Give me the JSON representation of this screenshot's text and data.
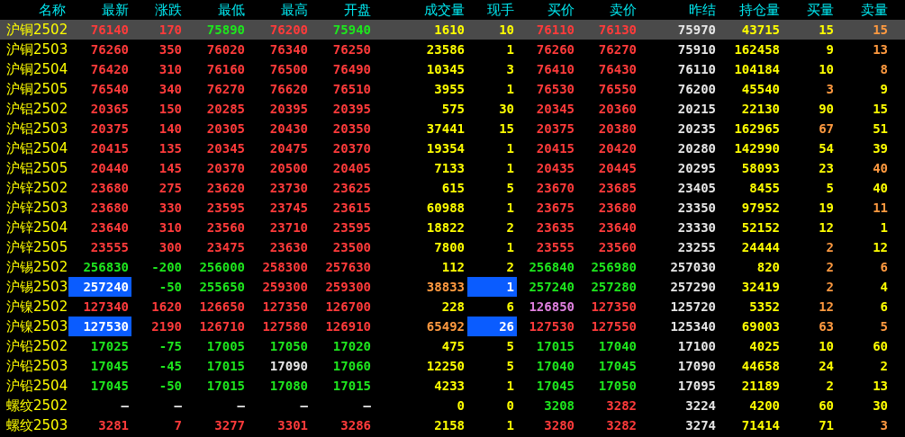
{
  "table": {
    "columns": [
      "名称",
      "最新",
      "涨跌",
      "最低",
      "最高",
      "开盘",
      "成交量",
      "现手",
      "买价",
      "卖价",
      "昨结",
      "持仓量",
      "买量",
      "卖量"
    ],
    "rows": [
      {
        "selected": true,
        "cells": [
          {
            "text": "沪铜2502",
            "kind": "name"
          },
          {
            "text": "76140",
            "kind": "up"
          },
          {
            "text": "170",
            "kind": "up"
          },
          {
            "text": "75890",
            "kind": "down"
          },
          {
            "text": "76200",
            "kind": "up"
          },
          {
            "text": "75940",
            "kind": "down"
          },
          {
            "text": "1610",
            "kind": "volume"
          },
          {
            "text": "10",
            "kind": "volume"
          },
          {
            "text": "76110",
            "kind": "up"
          },
          {
            "text": "76130",
            "kind": "up"
          },
          {
            "text": "75970",
            "kind": "flat"
          },
          {
            "text": "43715",
            "kind": "volume"
          },
          {
            "text": "15",
            "kind": "volume"
          },
          {
            "text": "15",
            "kind": "large"
          }
        ]
      },
      {
        "selected": false,
        "cells": [
          {
            "text": "沪铜2503",
            "kind": "name"
          },
          {
            "text": "76260",
            "kind": "up"
          },
          {
            "text": "350",
            "kind": "up"
          },
          {
            "text": "76020",
            "kind": "up"
          },
          {
            "text": "76340",
            "kind": "up"
          },
          {
            "text": "76250",
            "kind": "up"
          },
          {
            "text": "23586",
            "kind": "volume"
          },
          {
            "text": "1",
            "kind": "volume"
          },
          {
            "text": "76260",
            "kind": "up"
          },
          {
            "text": "76270",
            "kind": "up"
          },
          {
            "text": "75910",
            "kind": "flat"
          },
          {
            "text": "162458",
            "kind": "volume"
          },
          {
            "text": "9",
            "kind": "volume"
          },
          {
            "text": "13",
            "kind": "large"
          }
        ]
      },
      {
        "selected": false,
        "cells": [
          {
            "text": "沪铜2504",
            "kind": "name"
          },
          {
            "text": "76420",
            "kind": "up"
          },
          {
            "text": "310",
            "kind": "up"
          },
          {
            "text": "76160",
            "kind": "up"
          },
          {
            "text": "76500",
            "kind": "up"
          },
          {
            "text": "76490",
            "kind": "up"
          },
          {
            "text": "10345",
            "kind": "volume"
          },
          {
            "text": "3",
            "kind": "volume"
          },
          {
            "text": "76410",
            "kind": "up"
          },
          {
            "text": "76430",
            "kind": "up"
          },
          {
            "text": "76110",
            "kind": "flat"
          },
          {
            "text": "104184",
            "kind": "volume"
          },
          {
            "text": "10",
            "kind": "volume"
          },
          {
            "text": "8",
            "kind": "large"
          }
        ]
      },
      {
        "selected": false,
        "cells": [
          {
            "text": "沪铜2505",
            "kind": "name"
          },
          {
            "text": "76540",
            "kind": "up"
          },
          {
            "text": "340",
            "kind": "up"
          },
          {
            "text": "76270",
            "kind": "up"
          },
          {
            "text": "76620",
            "kind": "up"
          },
          {
            "text": "76510",
            "kind": "up"
          },
          {
            "text": "3955",
            "kind": "volume"
          },
          {
            "text": "1",
            "kind": "volume"
          },
          {
            "text": "76530",
            "kind": "up"
          },
          {
            "text": "76550",
            "kind": "up"
          },
          {
            "text": "76200",
            "kind": "flat"
          },
          {
            "text": "45540",
            "kind": "volume"
          },
          {
            "text": "3",
            "kind": "large"
          },
          {
            "text": "9",
            "kind": "volume"
          }
        ]
      },
      {
        "selected": false,
        "cells": [
          {
            "text": "沪铝2502",
            "kind": "name"
          },
          {
            "text": "20365",
            "kind": "up"
          },
          {
            "text": "150",
            "kind": "up"
          },
          {
            "text": "20285",
            "kind": "up"
          },
          {
            "text": "20395",
            "kind": "up"
          },
          {
            "text": "20395",
            "kind": "up"
          },
          {
            "text": "575",
            "kind": "volume"
          },
          {
            "text": "30",
            "kind": "volume"
          },
          {
            "text": "20345",
            "kind": "up"
          },
          {
            "text": "20360",
            "kind": "up"
          },
          {
            "text": "20215",
            "kind": "flat"
          },
          {
            "text": "22130",
            "kind": "volume"
          },
          {
            "text": "90",
            "kind": "volume"
          },
          {
            "text": "15",
            "kind": "volume"
          }
        ]
      },
      {
        "selected": false,
        "cells": [
          {
            "text": "沪铝2503",
            "kind": "name"
          },
          {
            "text": "20375",
            "kind": "up"
          },
          {
            "text": "140",
            "kind": "up"
          },
          {
            "text": "20305",
            "kind": "up"
          },
          {
            "text": "20430",
            "kind": "up"
          },
          {
            "text": "20350",
            "kind": "up"
          },
          {
            "text": "37441",
            "kind": "volume"
          },
          {
            "text": "15",
            "kind": "volume"
          },
          {
            "text": "20375",
            "kind": "up"
          },
          {
            "text": "20380",
            "kind": "up"
          },
          {
            "text": "20235",
            "kind": "flat"
          },
          {
            "text": "162965",
            "kind": "volume"
          },
          {
            "text": "67",
            "kind": "large"
          },
          {
            "text": "51",
            "kind": "volume"
          }
        ]
      },
      {
        "selected": false,
        "cells": [
          {
            "text": "沪铝2504",
            "kind": "name"
          },
          {
            "text": "20415",
            "kind": "up"
          },
          {
            "text": "135",
            "kind": "up"
          },
          {
            "text": "20345",
            "kind": "up"
          },
          {
            "text": "20475",
            "kind": "up"
          },
          {
            "text": "20370",
            "kind": "up"
          },
          {
            "text": "19354",
            "kind": "volume"
          },
          {
            "text": "1",
            "kind": "volume"
          },
          {
            "text": "20415",
            "kind": "up"
          },
          {
            "text": "20420",
            "kind": "up"
          },
          {
            "text": "20280",
            "kind": "flat"
          },
          {
            "text": "142990",
            "kind": "volume"
          },
          {
            "text": "54",
            "kind": "volume"
          },
          {
            "text": "39",
            "kind": "volume"
          }
        ]
      },
      {
        "selected": false,
        "cells": [
          {
            "text": "沪铝2505",
            "kind": "name"
          },
          {
            "text": "20440",
            "kind": "up"
          },
          {
            "text": "145",
            "kind": "up"
          },
          {
            "text": "20370",
            "kind": "up"
          },
          {
            "text": "20500",
            "kind": "up"
          },
          {
            "text": "20405",
            "kind": "up"
          },
          {
            "text": "7133",
            "kind": "volume"
          },
          {
            "text": "1",
            "kind": "volume"
          },
          {
            "text": "20435",
            "kind": "up"
          },
          {
            "text": "20445",
            "kind": "up"
          },
          {
            "text": "20295",
            "kind": "flat"
          },
          {
            "text": "58093",
            "kind": "volume"
          },
          {
            "text": "23",
            "kind": "volume"
          },
          {
            "text": "40",
            "kind": "large"
          }
        ]
      },
      {
        "selected": false,
        "cells": [
          {
            "text": "沪锌2502",
            "kind": "name"
          },
          {
            "text": "23680",
            "kind": "up"
          },
          {
            "text": "275",
            "kind": "up"
          },
          {
            "text": "23620",
            "kind": "up"
          },
          {
            "text": "23730",
            "kind": "up"
          },
          {
            "text": "23625",
            "kind": "up"
          },
          {
            "text": "615",
            "kind": "volume"
          },
          {
            "text": "5",
            "kind": "volume"
          },
          {
            "text": "23670",
            "kind": "up"
          },
          {
            "text": "23685",
            "kind": "up"
          },
          {
            "text": "23405",
            "kind": "flat"
          },
          {
            "text": "8455",
            "kind": "volume"
          },
          {
            "text": "5",
            "kind": "volume"
          },
          {
            "text": "40",
            "kind": "volume"
          }
        ]
      },
      {
        "selected": false,
        "cells": [
          {
            "text": "沪锌2503",
            "kind": "name"
          },
          {
            "text": "23680",
            "kind": "up"
          },
          {
            "text": "330",
            "kind": "up"
          },
          {
            "text": "23595",
            "kind": "up"
          },
          {
            "text": "23745",
            "kind": "up"
          },
          {
            "text": "23615",
            "kind": "up"
          },
          {
            "text": "60988",
            "kind": "volume"
          },
          {
            "text": "1",
            "kind": "volume"
          },
          {
            "text": "23675",
            "kind": "up"
          },
          {
            "text": "23680",
            "kind": "up"
          },
          {
            "text": "23350",
            "kind": "flat"
          },
          {
            "text": "97952",
            "kind": "volume"
          },
          {
            "text": "19",
            "kind": "volume"
          },
          {
            "text": "11",
            "kind": "large"
          }
        ]
      },
      {
        "selected": false,
        "cells": [
          {
            "text": "沪锌2504",
            "kind": "name"
          },
          {
            "text": "23640",
            "kind": "up"
          },
          {
            "text": "310",
            "kind": "up"
          },
          {
            "text": "23560",
            "kind": "up"
          },
          {
            "text": "23710",
            "kind": "up"
          },
          {
            "text": "23595",
            "kind": "up"
          },
          {
            "text": "18822",
            "kind": "volume"
          },
          {
            "text": "2",
            "kind": "volume"
          },
          {
            "text": "23635",
            "kind": "up"
          },
          {
            "text": "23640",
            "kind": "up"
          },
          {
            "text": "23330",
            "kind": "flat"
          },
          {
            "text": "52152",
            "kind": "volume"
          },
          {
            "text": "12",
            "kind": "volume"
          },
          {
            "text": "1",
            "kind": "volume"
          }
        ]
      },
      {
        "selected": false,
        "cells": [
          {
            "text": "沪锌2505",
            "kind": "name"
          },
          {
            "text": "23555",
            "kind": "up"
          },
          {
            "text": "300",
            "kind": "up"
          },
          {
            "text": "23475",
            "kind": "up"
          },
          {
            "text": "23630",
            "kind": "up"
          },
          {
            "text": "23500",
            "kind": "up"
          },
          {
            "text": "7800",
            "kind": "volume"
          },
          {
            "text": "1",
            "kind": "volume"
          },
          {
            "text": "23555",
            "kind": "up"
          },
          {
            "text": "23560",
            "kind": "up"
          },
          {
            "text": "23255",
            "kind": "flat"
          },
          {
            "text": "24444",
            "kind": "volume"
          },
          {
            "text": "2",
            "kind": "large"
          },
          {
            "text": "12",
            "kind": "volume"
          }
        ]
      },
      {
        "selected": false,
        "cells": [
          {
            "text": "沪锡2502",
            "kind": "name"
          },
          {
            "text": "256830",
            "kind": "down"
          },
          {
            "text": "-200",
            "kind": "down"
          },
          {
            "text": "256000",
            "kind": "down"
          },
          {
            "text": "258300",
            "kind": "up"
          },
          {
            "text": "257630",
            "kind": "up"
          },
          {
            "text": "112",
            "kind": "volume"
          },
          {
            "text": "2",
            "kind": "volume"
          },
          {
            "text": "256840",
            "kind": "down"
          },
          {
            "text": "256980",
            "kind": "down"
          },
          {
            "text": "257030",
            "kind": "flat"
          },
          {
            "text": "820",
            "kind": "volume"
          },
          {
            "text": "2",
            "kind": "large"
          },
          {
            "text": "6",
            "kind": "large"
          }
        ]
      },
      {
        "selected": false,
        "cells": [
          {
            "text": "沪锡2503",
            "kind": "name"
          },
          {
            "text": "257240",
            "kind": "cursor"
          },
          {
            "text": "-50",
            "kind": "down"
          },
          {
            "text": "255650",
            "kind": "down"
          },
          {
            "text": "259300",
            "kind": "up"
          },
          {
            "text": "259300",
            "kind": "up"
          },
          {
            "text": "38833",
            "kind": "large"
          },
          {
            "text": "1",
            "kind": "cursor"
          },
          {
            "text": "257240",
            "kind": "down"
          },
          {
            "text": "257280",
            "kind": "down"
          },
          {
            "text": "257290",
            "kind": "flat"
          },
          {
            "text": "32419",
            "kind": "volume"
          },
          {
            "text": "2",
            "kind": "large"
          },
          {
            "text": "4",
            "kind": "volume"
          }
        ]
      },
      {
        "selected": false,
        "cells": [
          {
            "text": "沪镍2502",
            "kind": "name"
          },
          {
            "text": "127340",
            "kind": "up"
          },
          {
            "text": "1620",
            "kind": "up"
          },
          {
            "text": "126650",
            "kind": "up"
          },
          {
            "text": "127350",
            "kind": "up"
          },
          {
            "text": "126700",
            "kind": "up"
          },
          {
            "text": "228",
            "kind": "volume"
          },
          {
            "text": "6",
            "kind": "volume"
          },
          {
            "text": "126850",
            "kind": "special"
          },
          {
            "text": "127350",
            "kind": "up"
          },
          {
            "text": "125720",
            "kind": "flat"
          },
          {
            "text": "5352",
            "kind": "volume"
          },
          {
            "text": "12",
            "kind": "large"
          },
          {
            "text": "6",
            "kind": "volume"
          }
        ]
      },
      {
        "selected": false,
        "cells": [
          {
            "text": "沪镍2503",
            "kind": "name"
          },
          {
            "text": "127530",
            "kind": "cursor"
          },
          {
            "text": "2190",
            "kind": "up"
          },
          {
            "text": "126710",
            "kind": "up"
          },
          {
            "text": "127580",
            "kind": "up"
          },
          {
            "text": "126910",
            "kind": "up"
          },
          {
            "text": "65492",
            "kind": "large"
          },
          {
            "text": "26",
            "kind": "cursor"
          },
          {
            "text": "127530",
            "kind": "up"
          },
          {
            "text": "127550",
            "kind": "up"
          },
          {
            "text": "125340",
            "kind": "flat"
          },
          {
            "text": "69003",
            "kind": "volume"
          },
          {
            "text": "63",
            "kind": "large"
          },
          {
            "text": "5",
            "kind": "large"
          }
        ]
      },
      {
        "selected": false,
        "cells": [
          {
            "text": "沪铅2502",
            "kind": "name"
          },
          {
            "text": "17025",
            "kind": "down"
          },
          {
            "text": "-75",
            "kind": "down"
          },
          {
            "text": "17005",
            "kind": "down"
          },
          {
            "text": "17050",
            "kind": "down"
          },
          {
            "text": "17020",
            "kind": "down"
          },
          {
            "text": "475",
            "kind": "volume"
          },
          {
            "text": "5",
            "kind": "volume"
          },
          {
            "text": "17015",
            "kind": "down"
          },
          {
            "text": "17040",
            "kind": "down"
          },
          {
            "text": "17100",
            "kind": "flat"
          },
          {
            "text": "4025",
            "kind": "volume"
          },
          {
            "text": "10",
            "kind": "volume"
          },
          {
            "text": "60",
            "kind": "volume"
          }
        ]
      },
      {
        "selected": false,
        "cells": [
          {
            "text": "沪铅2503",
            "kind": "name"
          },
          {
            "text": "17045",
            "kind": "down"
          },
          {
            "text": "-45",
            "kind": "down"
          },
          {
            "text": "17015",
            "kind": "down"
          },
          {
            "text": "17090",
            "kind": "flat"
          },
          {
            "text": "17060",
            "kind": "down"
          },
          {
            "text": "12250",
            "kind": "volume"
          },
          {
            "text": "5",
            "kind": "volume"
          },
          {
            "text": "17040",
            "kind": "down"
          },
          {
            "text": "17045",
            "kind": "down"
          },
          {
            "text": "17090",
            "kind": "flat"
          },
          {
            "text": "44658",
            "kind": "volume"
          },
          {
            "text": "24",
            "kind": "volume"
          },
          {
            "text": "2",
            "kind": "volume"
          }
        ]
      },
      {
        "selected": false,
        "cells": [
          {
            "text": "沪铅2504",
            "kind": "name"
          },
          {
            "text": "17045",
            "kind": "down"
          },
          {
            "text": "-50",
            "kind": "down"
          },
          {
            "text": "17015",
            "kind": "down"
          },
          {
            "text": "17080",
            "kind": "down"
          },
          {
            "text": "17015",
            "kind": "down"
          },
          {
            "text": "4233",
            "kind": "volume"
          },
          {
            "text": "1",
            "kind": "volume"
          },
          {
            "text": "17045",
            "kind": "down"
          },
          {
            "text": "17050",
            "kind": "down"
          },
          {
            "text": "17095",
            "kind": "flat"
          },
          {
            "text": "21189",
            "kind": "volume"
          },
          {
            "text": "2",
            "kind": "volume"
          },
          {
            "text": "13",
            "kind": "volume"
          }
        ]
      },
      {
        "selected": false,
        "cells": [
          {
            "text": "螺纹2502",
            "kind": "name"
          },
          {
            "text": "—",
            "kind": "flat"
          },
          {
            "text": "—",
            "kind": "flat"
          },
          {
            "text": "—",
            "kind": "flat"
          },
          {
            "text": "—",
            "kind": "flat"
          },
          {
            "text": "—",
            "kind": "flat"
          },
          {
            "text": "0",
            "kind": "volume"
          },
          {
            "text": "0",
            "kind": "volume"
          },
          {
            "text": "3208",
            "kind": "down"
          },
          {
            "text": "3282",
            "kind": "up"
          },
          {
            "text": "3224",
            "kind": "flat"
          },
          {
            "text": "4200",
            "kind": "volume"
          },
          {
            "text": "60",
            "kind": "volume"
          },
          {
            "text": "30",
            "kind": "volume"
          }
        ]
      },
      {
        "selected": false,
        "cells": [
          {
            "text": "螺纹2503",
            "kind": "name"
          },
          {
            "text": "3281",
            "kind": "up"
          },
          {
            "text": "7",
            "kind": "up"
          },
          {
            "text": "3277",
            "kind": "up"
          },
          {
            "text": "3301",
            "kind": "up"
          },
          {
            "text": "3286",
            "kind": "up"
          },
          {
            "text": "2158",
            "kind": "volume"
          },
          {
            "text": "1",
            "kind": "volume"
          },
          {
            "text": "3280",
            "kind": "up"
          },
          {
            "text": "3282",
            "kind": "up"
          },
          {
            "text": "3274",
            "kind": "flat"
          },
          {
            "text": "71414",
            "kind": "volume"
          },
          {
            "text": "71",
            "kind": "volume"
          },
          {
            "text": "3",
            "kind": "large"
          }
        ]
      }
    ]
  }
}
